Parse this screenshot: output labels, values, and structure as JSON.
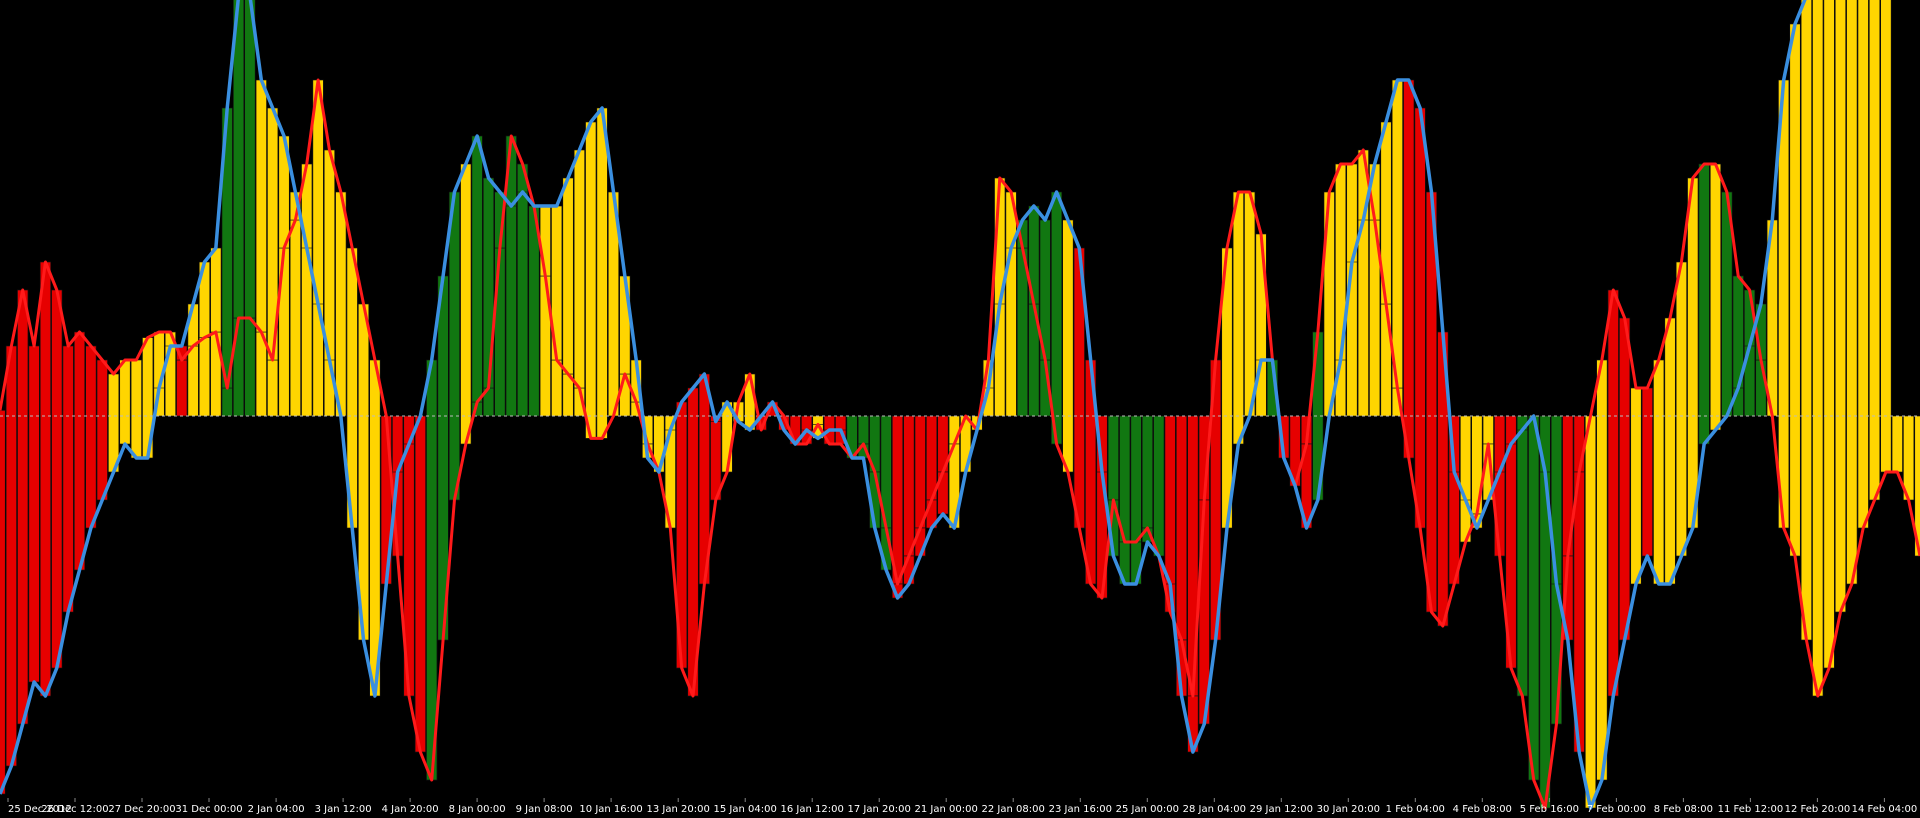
{
  "chart_data": {
    "type": "area",
    "x_tick_labels": [
      "25 Dec 2012",
      "26 Dec 12:00",
      "27 Dec 20:00",
      "31 Dec 00:00",
      "2 Jan 04:00",
      "3 Jan 12:00",
      "4 Jan 20:00",
      "8 Jan 00:00",
      "9 Jan 08:00",
      "10 Jan 16:00",
      "13 Jan 20:00",
      "15 Jan 04:00",
      "16 Jan 12:00",
      "17 Jan 20:00",
      "21 Jan 00:00",
      "22 Jan 08:00",
      "23 Jan 16:00",
      "25 Jan 00:00",
      "28 Jan 04:00",
      "29 Jan 12:00",
      "30 Jan 20:00",
      "1 Feb 04:00",
      "4 Feb 08:00",
      "5 Feb 16:00",
      "7 Feb 00:00",
      "8 Feb 08:00",
      "11 Feb 12:00",
      "12 Feb 20:00",
      "14 Feb 04:00"
    ],
    "ylim": [
      -100,
      100
    ],
    "zero_line": true,
    "colors": {
      "background": "#000000",
      "red_fill": "#e60000",
      "yellow_fill": "#ffd500",
      "green_fill": "#117711",
      "red_line": "#ff1a1a",
      "blue_line": "#3a8fe0",
      "bar_edge": "#111111",
      "zero_line": "#bbbbbb",
      "tick_text": "#ffffff"
    },
    "series": [
      {
        "key": "fast",
        "line_color": "red",
        "values": [
          2,
          25,
          45,
          25,
          55,
          45,
          25,
          30,
          25,
          20,
          15,
          20,
          20,
          28,
          30,
          30,
          20,
          25,
          28,
          30,
          10,
          35,
          35,
          30,
          20,
          60,
          70,
          90,
          120,
          95,
          80,
          60,
          40,
          20,
          0,
          -50,
          -100,
          -120,
          -130,
          -80,
          -30,
          -10,
          5,
          10,
          60,
          100,
          90,
          75,
          50,
          20,
          15,
          10,
          -8,
          -8,
          0,
          15,
          5,
          -10,
          -20,
          -40,
          -90,
          -100,
          -60,
          -30,
          -20,
          5,
          15,
          -5,
          5,
          0,
          -10,
          -10,
          -3,
          -10,
          -10,
          -15,
          -10,
          -20,
          -40,
          -60,
          -50,
          -40,
          -30,
          -20,
          -10,
          0,
          -5,
          20,
          85,
          80,
          60,
          40,
          20,
          -10,
          -20,
          -40,
          -60,
          -65,
          -30,
          -45,
          -45,
          -40,
          -50,
          -70,
          -80,
          -100,
          -30,
          20,
          60,
          80,
          80,
          65,
          20,
          -15,
          -25,
          -10,
          30,
          80,
          90,
          90,
          95,
          70,
          40,
          10,
          -15,
          -40,
          -70,
          -75,
          -60,
          -45,
          -35,
          -10,
          -50,
          -90,
          -100,
          -130,
          -140,
          -110,
          -50,
          -20,
          0,
          20,
          45,
          35,
          10,
          10,
          20,
          35,
          55,
          85,
          90,
          90,
          80,
          50,
          45,
          20,
          0,
          -40,
          -50,
          -80,
          -100,
          -90,
          -70,
          -60,
          -40,
          -30,
          -20,
          -20,
          -30,
          -50
        ],
        "fills": [
          "red",
          "red",
          "red",
          "red",
          "red",
          "red",
          "red",
          "red",
          "red",
          "red",
          "yellow",
          "yellow",
          "yellow",
          "yellow",
          "yellow",
          "yellow",
          "red",
          "yellow",
          "yellow",
          "yellow",
          "green",
          "green",
          "green",
          "yellow",
          "yellow",
          "yellow",
          "yellow",
          "yellow",
          "yellow",
          "yellow",
          "yellow",
          "yellow",
          "yellow",
          "yellow",
          "red",
          "red",
          "red",
          "red",
          "green",
          "green",
          "green",
          "yellow",
          "green",
          "green",
          "green",
          "green",
          "green",
          "green",
          "yellow",
          "yellow",
          "yellow",
          "yellow",
          "yellow",
          "yellow",
          "yellow",
          "yellow",
          "yellow",
          "yellow",
          "yellow",
          "yellow",
          "red",
          "red",
          "red",
          "red",
          "yellow",
          "yellow",
          "yellow",
          "red",
          "red",
          "red",
          "red",
          "red",
          "yellow",
          "red",
          "red",
          "green",
          "green",
          "green",
          "green",
          "red",
          "red",
          "red",
          "red",
          "red",
          "yellow",
          "yellow",
          "yellow",
          "yellow",
          "yellow",
          "yellow",
          "green",
          "green",
          "green",
          "green",
          "yellow",
          "red",
          "red",
          "red",
          "green",
          "green",
          "green",
          "green",
          "green",
          "red",
          "red",
          "red",
          "red",
          "red",
          "yellow",
          "yellow",
          "yellow",
          "yellow",
          "green",
          "red",
          "red",
          "red",
          "green",
          "yellow",
          "yellow",
          "yellow",
          "yellow",
          "yellow",
          "yellow",
          "yellow",
          "red",
          "red",
          "red",
          "red",
          "red",
          "yellow",
          "yellow",
          "yellow",
          "red",
          "red",
          "green",
          "green",
          "green",
          "green",
          "red",
          "red",
          "yellow",
          "yellow",
          "red",
          "red",
          "yellow",
          "red",
          "yellow",
          "yellow",
          "yellow",
          "yellow",
          "green",
          "yellow",
          "green",
          "green",
          "green",
          "green",
          "yellow",
          "yellow",
          "yellow",
          "yellow",
          "yellow",
          "yellow",
          "yellow",
          "yellow",
          "yellow",
          "yellow",
          "yellow",
          "yellow",
          "yellow",
          "yellow",
          "yellow",
          "yellow",
          "yellow",
          "yellow",
          "yellow",
          "green"
        ]
      },
      {
        "key": "slow",
        "line_color": "blue",
        "values": [
          -135,
          -125,
          -110,
          -95,
          -100,
          -90,
          -70,
          -55,
          -40,
          -30,
          -20,
          -10,
          -15,
          -15,
          10,
          25,
          25,
          40,
          55,
          60,
          110,
          150,
          150,
          120,
          110,
          100,
          80,
          60,
          40,
          20,
          0,
          -40,
          -80,
          -100,
          -60,
          -20,
          -10,
          0,
          20,
          50,
          80,
          90,
          100,
          85,
          80,
          75,
          80,
          75,
          75,
          75,
          85,
          95,
          105,
          110,
          80,
          50,
          20,
          -15,
          -20,
          -5,
          5,
          10,
          15,
          -2,
          5,
          -2,
          -5,
          0,
          5,
          -5,
          -10,
          -5,
          -8,
          -5,
          -5,
          -15,
          -15,
          -40,
          -55,
          -65,
          -60,
          -50,
          -40,
          -35,
          -40,
          -20,
          -5,
          10,
          40,
          60,
          70,
          75,
          70,
          80,
          70,
          60,
          20,
          -20,
          -50,
          -60,
          -60,
          -45,
          -50,
          -60,
          -100,
          -120,
          -110,
          -80,
          -40,
          -10,
          0,
          20,
          20,
          -15,
          -25,
          -40,
          -30,
          0,
          20,
          55,
          70,
          90,
          105,
          120,
          120,
          110,
          80,
          30,
          -20,
          -30,
          -40,
          -30,
          -20,
          -10,
          -5,
          0,
          -20,
          -60,
          -80,
          -120,
          -140,
          -130,
          -100,
          -80,
          -60,
          -50,
          -60,
          -60,
          -50,
          -40,
          -10,
          -5,
          0,
          10,
          25,
          40,
          70,
          120,
          140,
          150,
          160,
          155,
          160,
          165,
          170,
          160,
          160
        ],
        "fills": [
          "red",
          "red",
          "red",
          "red",
          "red",
          "red",
          "red",
          "red",
          "red",
          "red",
          "yellow",
          "yellow",
          "yellow",
          "yellow",
          "yellow",
          "yellow",
          "red",
          "yellow",
          "yellow",
          "yellow",
          "green",
          "green",
          "green",
          "yellow",
          "yellow",
          "yellow",
          "yellow",
          "yellow",
          "yellow",
          "yellow",
          "yellow",
          "yellow",
          "yellow",
          "yellow",
          "red",
          "red",
          "red",
          "red",
          "green",
          "green",
          "green",
          "yellow",
          "green",
          "green",
          "green",
          "green",
          "green",
          "green",
          "yellow",
          "yellow",
          "yellow",
          "yellow",
          "yellow",
          "yellow",
          "yellow",
          "yellow",
          "yellow",
          "yellow",
          "yellow",
          "yellow",
          "red",
          "red",
          "red",
          "red",
          "yellow",
          "yellow",
          "yellow",
          "red",
          "red",
          "red",
          "red",
          "red",
          "yellow",
          "red",
          "red",
          "green",
          "green",
          "green",
          "green",
          "red",
          "red",
          "red",
          "red",
          "red",
          "yellow",
          "yellow",
          "yellow",
          "yellow",
          "yellow",
          "yellow",
          "green",
          "green",
          "green",
          "green",
          "yellow",
          "red",
          "red",
          "red",
          "green",
          "green",
          "green",
          "green",
          "green",
          "red",
          "red",
          "red",
          "red",
          "red",
          "yellow",
          "yellow",
          "yellow",
          "yellow",
          "green",
          "red",
          "red",
          "red",
          "green",
          "yellow",
          "yellow",
          "yellow",
          "yellow",
          "yellow",
          "yellow",
          "yellow",
          "red",
          "red",
          "red",
          "red",
          "red",
          "yellow",
          "yellow",
          "yellow",
          "red",
          "red",
          "green",
          "green",
          "green",
          "green",
          "red",
          "red",
          "yellow",
          "yellow",
          "red",
          "red",
          "yellow",
          "red",
          "yellow",
          "yellow",
          "yellow",
          "yellow",
          "green",
          "yellow",
          "green",
          "green",
          "green",
          "green",
          "yellow",
          "yellow",
          "yellow",
          "yellow",
          "yellow",
          "yellow",
          "yellow",
          "yellow",
          "yellow",
          "yellow",
          "yellow",
          "yellow",
          "yellow",
          "yellow",
          "yellow",
          "yellow",
          "yellow",
          "yellow",
          "yellow",
          "green"
        ]
      }
    ]
  }
}
